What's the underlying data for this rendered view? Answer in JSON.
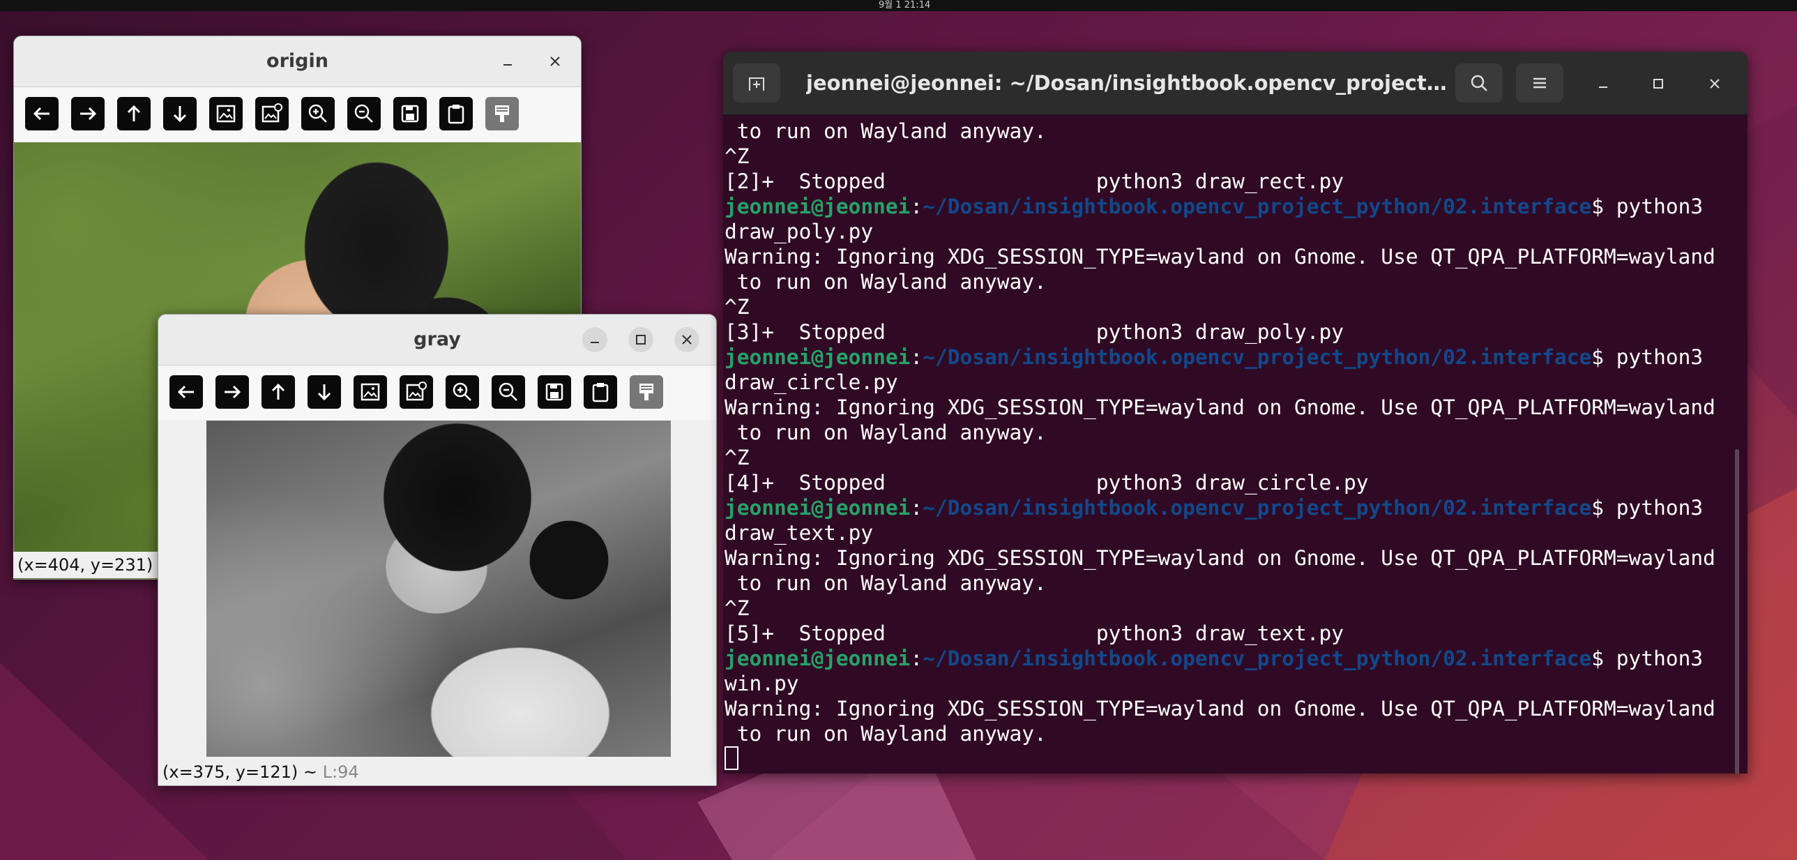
{
  "topbar": {
    "clock": "9월 1 21:14"
  },
  "origin_window": {
    "title": "origin",
    "status": "(x=404, y=231)",
    "toolbar": [
      "arrow-left-icon",
      "arrow-right-icon",
      "arrow-up-icon",
      "arrow-down-icon",
      "image-icon",
      "image-settings-icon",
      "zoom-in-icon",
      "zoom-out-icon",
      "save-icon",
      "clipboard-icon",
      "properties-icon"
    ]
  },
  "gray_window": {
    "title": "gray",
    "status_coords": "(x=375, y=121) ~",
    "status_lum": "L:94"
  },
  "terminal": {
    "title": "jeonnei@jeonnei: ~/Dosan/insightbook.opencv_project_pyth...",
    "prompt_user": "jeonnei@jeonnei",
    "prompt_sep": ":",
    "prompt_path": "~/Dosan/insightbook.opencv_project_python/02.interface",
    "prompt_end": "$ python3",
    "lines": {
      "l1": " to run on Wayland anyway.",
      "l2": "^Z",
      "l3": "[2]+  Stopped                 python3 draw_rect.py",
      "l5": "draw_poly.py",
      "l6": "Warning: Ignoring XDG_SESSION_TYPE=wayland on Gnome. Use QT_QPA_PLATFORM=wayland",
      "l7": " to run on Wayland anyway.",
      "l8": "^Z",
      "l9": "[3]+  Stopped                 python3 draw_poly.py",
      "l11": "draw_circle.py",
      "l12": "Warning: Ignoring XDG_SESSION_TYPE=wayland on Gnome. Use QT_QPA_PLATFORM=wayland",
      "l13": " to run on Wayland anyway.",
      "l14": "^Z",
      "l15": "[4]+  Stopped                 python3 draw_circle.py",
      "l17": "draw_text.py",
      "l18": "Warning: Ignoring XDG_SESSION_TYPE=wayland on Gnome. Use QT_QPA_PLATFORM=wayland",
      "l19": " to run on Wayland anyway.",
      "l20": "^Z",
      "l21": "[5]+  Stopped                 python3 draw_text.py",
      "l23": "win.py",
      "l24": "Warning: Ignoring XDG_SESSION_TYPE=wayland on Gnome. Use QT_QPA_PLATFORM=wayland",
      "l25": " to run on Wayland anyway."
    }
  },
  "colors": {
    "terminal_bg": "#300a24",
    "prompt_user": "#26a269",
    "prompt_path": "#12488b"
  }
}
